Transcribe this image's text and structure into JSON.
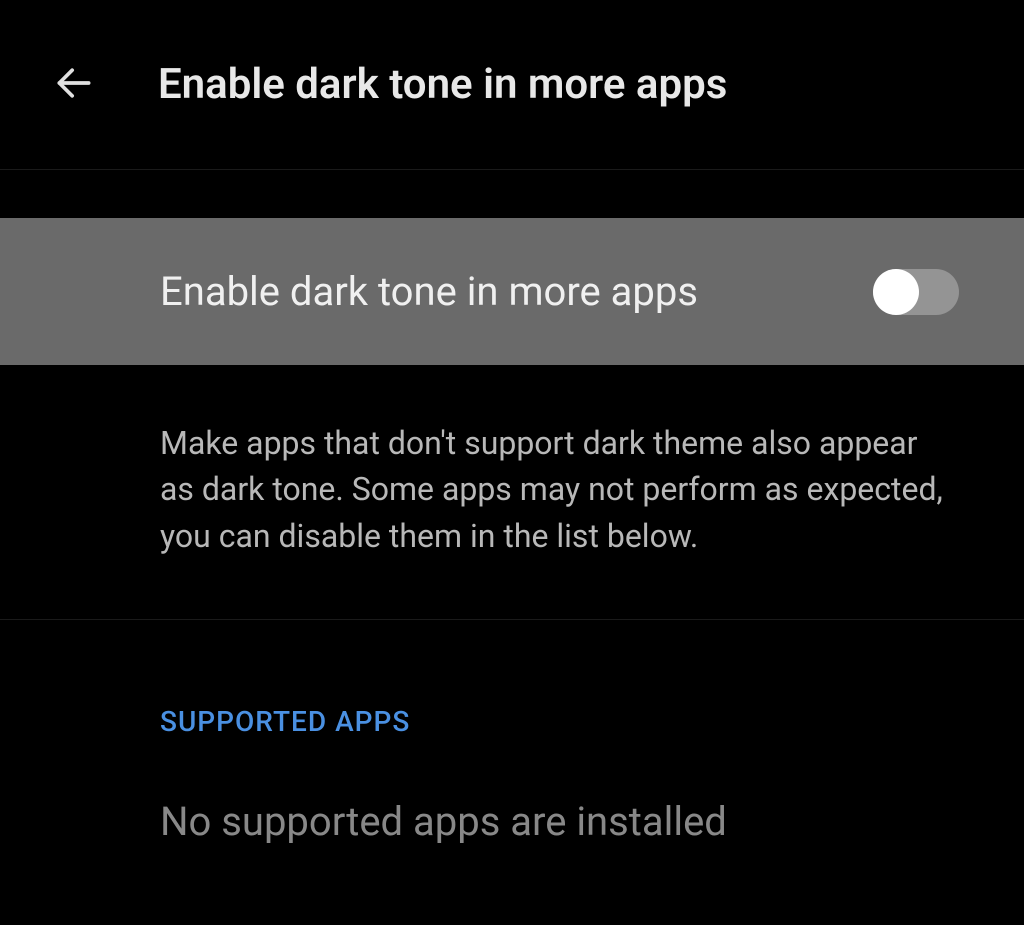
{
  "header": {
    "title": "Enable dark tone in more apps"
  },
  "toggle": {
    "label": "Enable dark tone in more apps",
    "state": "off"
  },
  "description": "Make apps that don't support dark theme also appear as dark tone. Some apps may not perform as expected, you can disable them in the list below.",
  "section": {
    "header": "SUPPORTED APPS",
    "empty_message": "No supported apps are installed"
  }
}
